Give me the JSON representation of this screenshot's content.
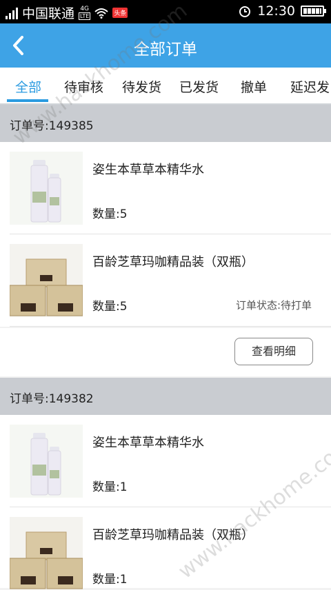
{
  "status_bar": {
    "carrier": "中国联通",
    "network": "4G",
    "lte": "LTE",
    "news_badge": "头条",
    "time": "12:30",
    "icons": [
      "signal-icon",
      "wifi-icon",
      "alarm-icon",
      "battery-icon"
    ]
  },
  "header": {
    "title": "全部订单",
    "back_icon": "chevron-left-icon"
  },
  "tabs": [
    {
      "label": "全部"
    },
    {
      "label": "待审核"
    },
    {
      "label": "待发货"
    },
    {
      "label": "已发货"
    },
    {
      "label": "撤单"
    },
    {
      "label": "延迟发"
    }
  ],
  "orders": [
    {
      "order_label": "订单号:149385",
      "items": [
        {
          "name": "姿生本草草本精华水",
          "qty": "数量:5",
          "thumb": "serum-bottle-image"
        },
        {
          "name": "百龄芝草玛咖精品装（双瓶）",
          "qty": "数量:5",
          "status": "订单状态:待打单",
          "thumb": "maca-box-image"
        }
      ],
      "detail_button": "查看明细"
    },
    {
      "order_label": "订单号:149382",
      "items": [
        {
          "name": "姿生本草草本精华水",
          "qty": "数量:1",
          "thumb": "serum-bottle-image"
        },
        {
          "name": "百龄芝草玛咖精品装（双瓶）",
          "qty": "数量:1",
          "thumb": "maca-box-image"
        }
      ]
    }
  ],
  "colors": {
    "header_bg": "#3ea3e6",
    "accent": "#2b9be0",
    "order_header_bg": "#c9ccd1"
  },
  "watermark": "www.hackhome.com"
}
